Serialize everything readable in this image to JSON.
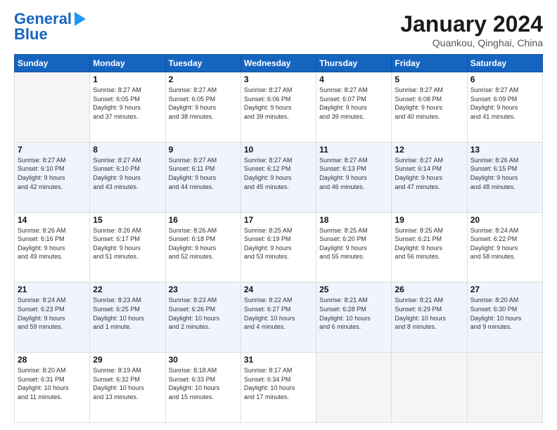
{
  "logo": {
    "line1": "General",
    "line2": "Blue"
  },
  "title": "January 2024",
  "subtitle": "Quankou, Qinghai, China",
  "weekdays": [
    "Sunday",
    "Monday",
    "Tuesday",
    "Wednesday",
    "Thursday",
    "Friday",
    "Saturday"
  ],
  "weeks": [
    [
      {
        "day": "",
        "info": ""
      },
      {
        "day": "1",
        "info": "Sunrise: 8:27 AM\nSunset: 6:05 PM\nDaylight: 9 hours\nand 37 minutes."
      },
      {
        "day": "2",
        "info": "Sunrise: 8:27 AM\nSunset: 6:05 PM\nDaylight: 9 hours\nand 38 minutes."
      },
      {
        "day": "3",
        "info": "Sunrise: 8:27 AM\nSunset: 6:06 PM\nDaylight: 9 hours\nand 39 minutes."
      },
      {
        "day": "4",
        "info": "Sunrise: 8:27 AM\nSunset: 6:07 PM\nDaylight: 9 hours\nand 39 minutes."
      },
      {
        "day": "5",
        "info": "Sunrise: 8:27 AM\nSunset: 6:08 PM\nDaylight: 9 hours\nand 40 minutes."
      },
      {
        "day": "6",
        "info": "Sunrise: 8:27 AM\nSunset: 6:09 PM\nDaylight: 9 hours\nand 41 minutes."
      }
    ],
    [
      {
        "day": "7",
        "info": "Sunrise: 8:27 AM\nSunset: 6:10 PM\nDaylight: 9 hours\nand 42 minutes."
      },
      {
        "day": "8",
        "info": "Sunrise: 8:27 AM\nSunset: 6:10 PM\nDaylight: 9 hours\nand 43 minutes."
      },
      {
        "day": "9",
        "info": "Sunrise: 8:27 AM\nSunset: 6:11 PM\nDaylight: 9 hours\nand 44 minutes."
      },
      {
        "day": "10",
        "info": "Sunrise: 8:27 AM\nSunset: 6:12 PM\nDaylight: 9 hours\nand 45 minutes."
      },
      {
        "day": "11",
        "info": "Sunrise: 8:27 AM\nSunset: 6:13 PM\nDaylight: 9 hours\nand 46 minutes."
      },
      {
        "day": "12",
        "info": "Sunrise: 8:27 AM\nSunset: 6:14 PM\nDaylight: 9 hours\nand 47 minutes."
      },
      {
        "day": "13",
        "info": "Sunrise: 8:26 AM\nSunset: 6:15 PM\nDaylight: 9 hours\nand 48 minutes."
      }
    ],
    [
      {
        "day": "14",
        "info": "Sunrise: 8:26 AM\nSunset: 6:16 PM\nDaylight: 9 hours\nand 49 minutes."
      },
      {
        "day": "15",
        "info": "Sunrise: 8:26 AM\nSunset: 6:17 PM\nDaylight: 9 hours\nand 51 minutes."
      },
      {
        "day": "16",
        "info": "Sunrise: 8:26 AM\nSunset: 6:18 PM\nDaylight: 9 hours\nand 52 minutes."
      },
      {
        "day": "17",
        "info": "Sunrise: 8:25 AM\nSunset: 6:19 PM\nDaylight: 9 hours\nand 53 minutes."
      },
      {
        "day": "18",
        "info": "Sunrise: 8:25 AM\nSunset: 6:20 PM\nDaylight: 9 hours\nand 55 minutes."
      },
      {
        "day": "19",
        "info": "Sunrise: 8:25 AM\nSunset: 6:21 PM\nDaylight: 9 hours\nand 56 minutes."
      },
      {
        "day": "20",
        "info": "Sunrise: 8:24 AM\nSunset: 6:22 PM\nDaylight: 9 hours\nand 58 minutes."
      }
    ],
    [
      {
        "day": "21",
        "info": "Sunrise: 8:24 AM\nSunset: 6:23 PM\nDaylight: 9 hours\nand 59 minutes."
      },
      {
        "day": "22",
        "info": "Sunrise: 8:23 AM\nSunset: 6:25 PM\nDaylight: 10 hours\nand 1 minute."
      },
      {
        "day": "23",
        "info": "Sunrise: 8:23 AM\nSunset: 6:26 PM\nDaylight: 10 hours\nand 2 minutes."
      },
      {
        "day": "24",
        "info": "Sunrise: 8:22 AM\nSunset: 6:27 PM\nDaylight: 10 hours\nand 4 minutes."
      },
      {
        "day": "25",
        "info": "Sunrise: 8:21 AM\nSunset: 6:28 PM\nDaylight: 10 hours\nand 6 minutes."
      },
      {
        "day": "26",
        "info": "Sunrise: 8:21 AM\nSunset: 6:29 PM\nDaylight: 10 hours\nand 8 minutes."
      },
      {
        "day": "27",
        "info": "Sunrise: 8:20 AM\nSunset: 6:30 PM\nDaylight: 10 hours\nand 9 minutes."
      }
    ],
    [
      {
        "day": "28",
        "info": "Sunrise: 8:20 AM\nSunset: 6:31 PM\nDaylight: 10 hours\nand 11 minutes."
      },
      {
        "day": "29",
        "info": "Sunrise: 8:19 AM\nSunset: 6:32 PM\nDaylight: 10 hours\nand 13 minutes."
      },
      {
        "day": "30",
        "info": "Sunrise: 8:18 AM\nSunset: 6:33 PM\nDaylight: 10 hours\nand 15 minutes."
      },
      {
        "day": "31",
        "info": "Sunrise: 8:17 AM\nSunset: 6:34 PM\nDaylight: 10 hours\nand 17 minutes."
      },
      {
        "day": "",
        "info": ""
      },
      {
        "day": "",
        "info": ""
      },
      {
        "day": "",
        "info": ""
      }
    ]
  ]
}
